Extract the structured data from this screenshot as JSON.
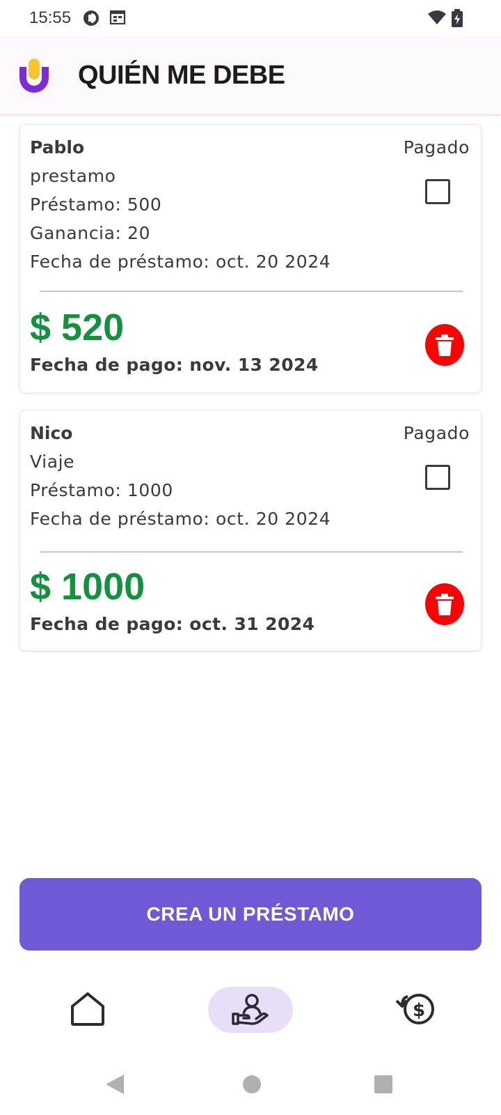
{
  "status_bar": {
    "time": "15:55",
    "left_icons": [
      "app-notification-icon",
      "calendar-icon"
    ],
    "right_icons": [
      "wifi-icon",
      "battery-charging-icon"
    ]
  },
  "app_bar": {
    "title": "QUIÉN ME DEBE",
    "logo": "app-logo-icon"
  },
  "loans": [
    {
      "name": "Pablo",
      "description": "prestamo",
      "loan_label": "Préstamo: 500",
      "profit_label": "Ganancia: 20",
      "loan_date_label": "Fecha de préstamo: oct. 20 2024",
      "paid_label": "Pagado",
      "paid": false,
      "total": "$ 520",
      "due_date_label": "Fecha de pago: nov. 13 2024"
    },
    {
      "name": "Nico",
      "description": "Viaje",
      "loan_label": "Préstamo: 1000",
      "loan_date_label": "Fecha de préstamo: oct. 20 2024",
      "paid_label": "Pagado",
      "paid": false,
      "total": "$ 1000",
      "due_date_label": "Fecha de pago: oct. 31 2024"
    }
  ],
  "actions": {
    "create_loan_label": "CREA UN PRÉSTAMO"
  },
  "bottom_nav": {
    "items": [
      {
        "icon": "home-icon",
        "active": false
      },
      {
        "icon": "hand-user-icon",
        "active": true
      },
      {
        "icon": "money-history-icon",
        "active": false
      }
    ]
  },
  "system_nav": {
    "icons": [
      "back-icon",
      "home-circle-icon",
      "recents-icon"
    ]
  },
  "colors": {
    "accent": "#7058d6",
    "amount_green": "#12913e",
    "delete_red": "#ff0000",
    "app_bar_bg": "#fdf7fe",
    "nav_active_bg": "#e8def8"
  }
}
